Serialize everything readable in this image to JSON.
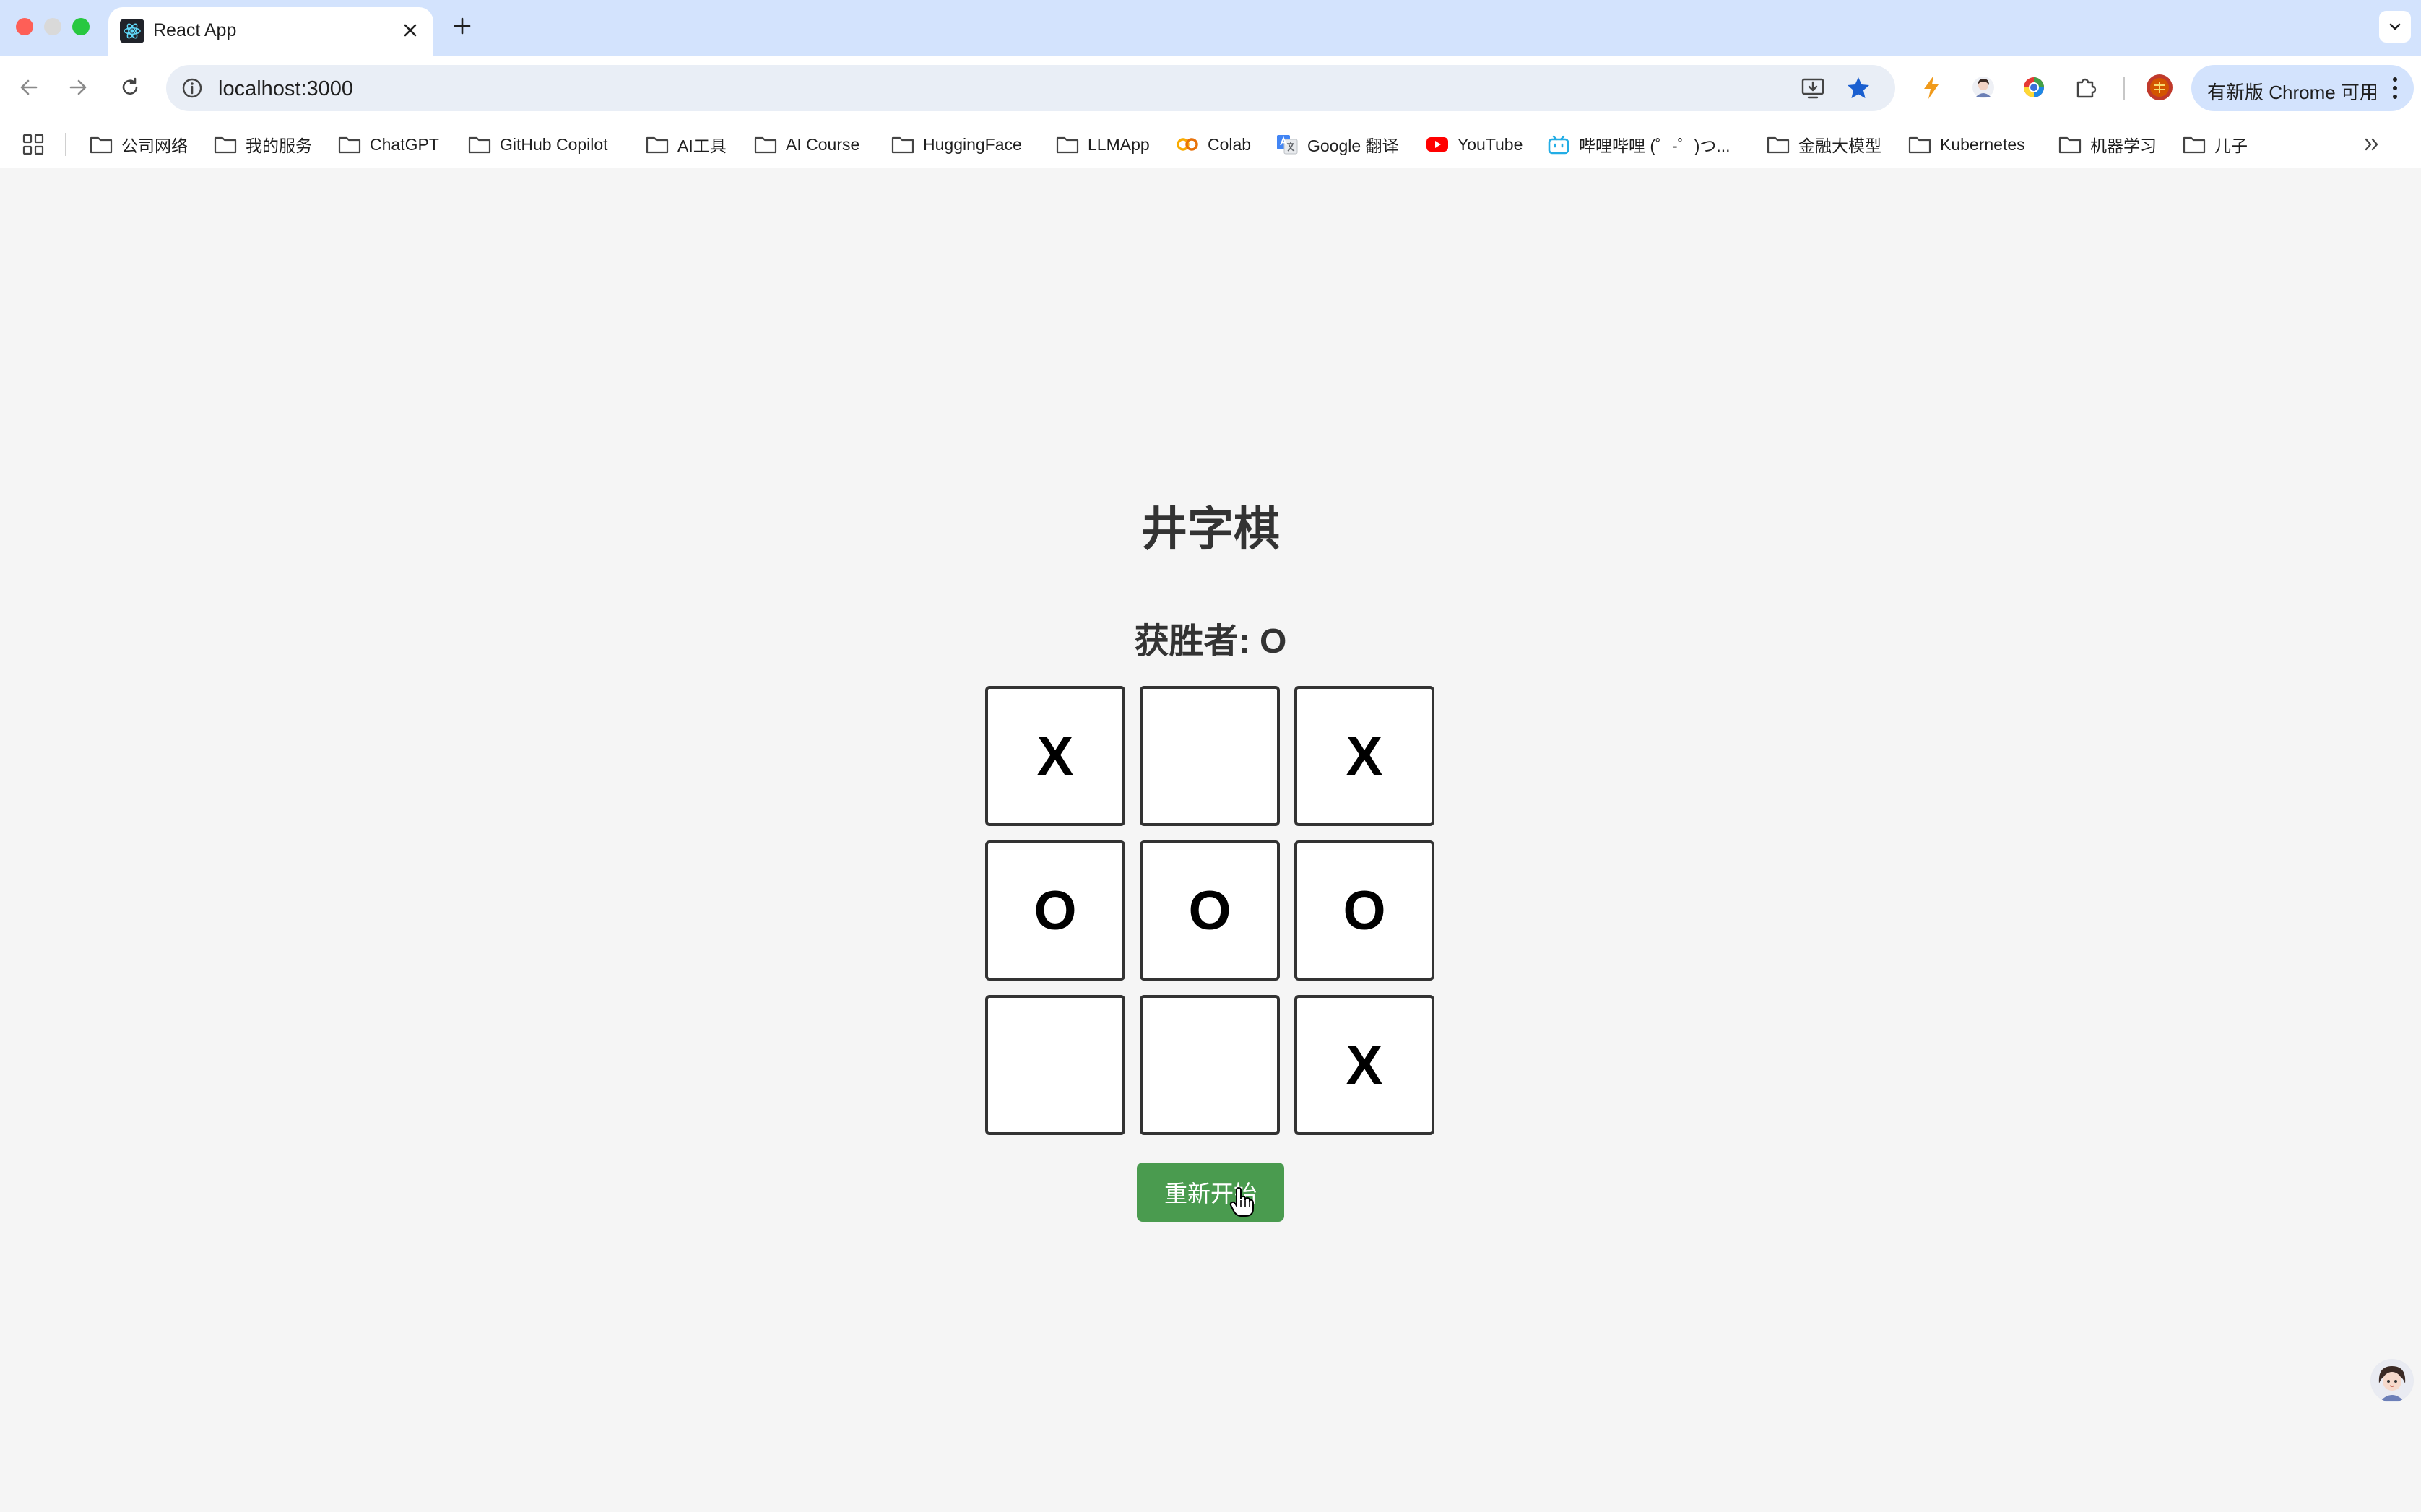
{
  "browser": {
    "tab": {
      "title": "React App"
    },
    "url": "localhost:3000",
    "update_button": "有新版 Chrome 可用",
    "bookmarks": [
      {
        "label": "公司网络",
        "icon": "folder-icon"
      },
      {
        "label": "我的服务",
        "icon": "folder-icon"
      },
      {
        "label": "ChatGPT",
        "icon": "folder-icon"
      },
      {
        "label": "GitHub Copilot",
        "icon": "folder-icon"
      },
      {
        "label": "AI工具",
        "icon": "folder-icon"
      },
      {
        "label": "AI Course",
        "icon": "folder-icon"
      },
      {
        "label": "HuggingFace",
        "icon": "folder-icon"
      },
      {
        "label": "LLMApp",
        "icon": "folder-icon"
      },
      {
        "label": "Colab",
        "icon": "colab-icon"
      },
      {
        "label": "Google 翻译",
        "icon": "google-translate-icon"
      },
      {
        "label": "YouTube",
        "icon": "youtube-icon"
      },
      {
        "label": "哔哩哔哩 (゜-゜)つ...",
        "icon": "bilibili-icon"
      },
      {
        "label": "金融大模型",
        "icon": "folder-icon"
      },
      {
        "label": "Kubernetes",
        "icon": "folder-icon"
      },
      {
        "label": "机器学习",
        "icon": "folder-icon"
      },
      {
        "label": "儿子",
        "icon": "folder-icon"
      }
    ]
  },
  "game": {
    "title": "井字棋",
    "status": "获胜者: O",
    "cells": [
      "X",
      "",
      "X",
      "O",
      "O",
      "O",
      "",
      "",
      "X"
    ],
    "restart_label": "重新开始"
  },
  "colors": {
    "tabstrip": "#d3e3fd",
    "button_green": "#4a9b4f",
    "page_bg": "#f5f5f5"
  }
}
